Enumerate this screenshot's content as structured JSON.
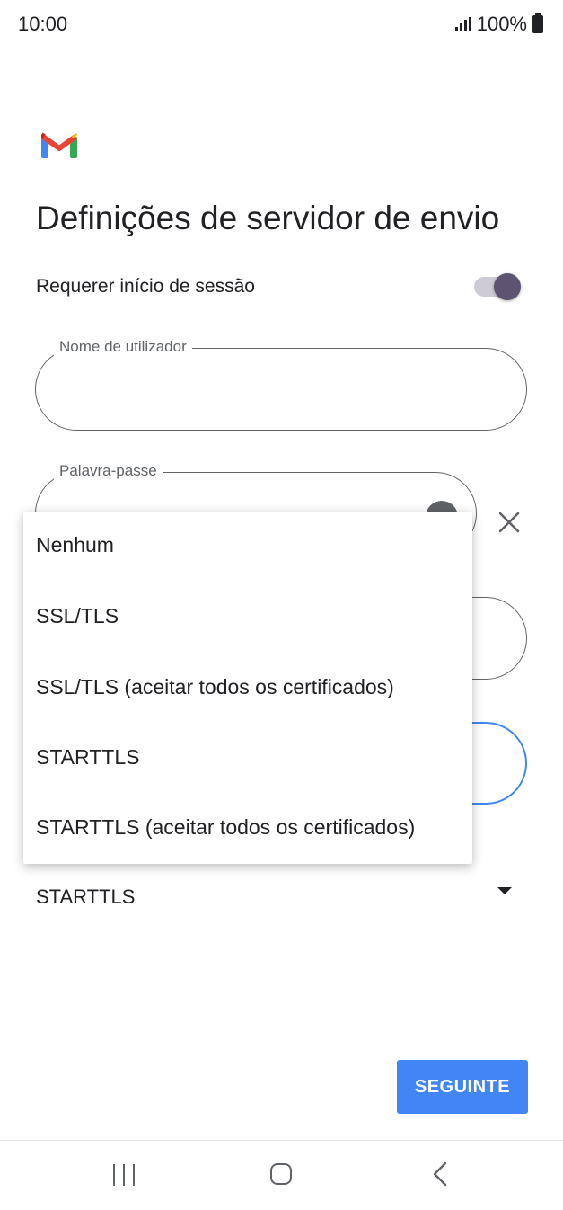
{
  "status_bar": {
    "time": "10:00",
    "battery": "100%"
  },
  "page": {
    "title": "Definições de servidor de envio",
    "require_login_label": "Requerer início de sessão",
    "require_login_enabled": true
  },
  "fields": {
    "username_label": "Nome de utilizador",
    "password_label": "Palavra-passe"
  },
  "security": {
    "selected": "STARTTLS"
  },
  "dropdown": {
    "options": [
      "Nenhum",
      "SSL/TLS",
      "SSL/TLS (aceitar todos os certificados)",
      "STARTTLS",
      "STARTTLS (aceitar todos os certificados)"
    ]
  },
  "buttons": {
    "next": "SEGUINTE"
  },
  "colors": {
    "accent": "#4285f4",
    "toggle_on": "#5d5470"
  },
  "icons": [
    "gmail-logo",
    "signal-icon",
    "battery-icon",
    "eye-icon",
    "clear-icon",
    "dropdown-arrow-icon",
    "nav-recent-icon",
    "nav-home-icon",
    "nav-back-icon"
  ]
}
